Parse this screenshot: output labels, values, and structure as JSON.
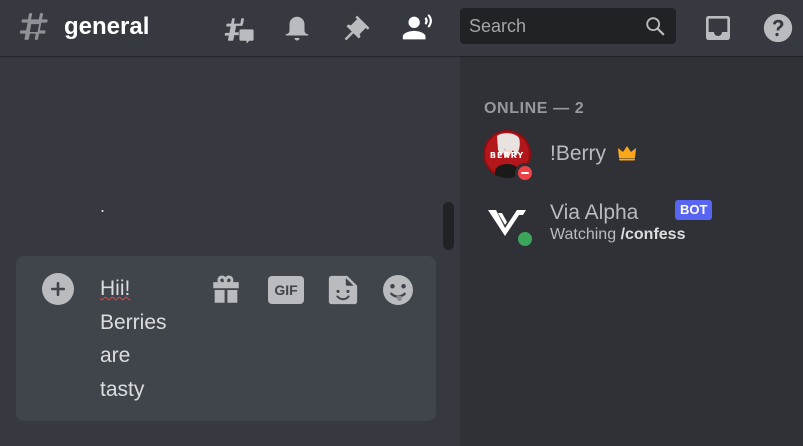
{
  "header": {
    "channel_name": "general",
    "search_placeholder": "Search"
  },
  "icons": {
    "channel": "hash-icon",
    "threads": "threads-icon",
    "notifications": "bell-icon",
    "pinned": "pin-icon",
    "members": "members-icon",
    "search": "search-icon",
    "inbox": "inbox-icon",
    "help": "help-icon"
  },
  "chat": {
    "stray_text": ".",
    "composer": {
      "message_words": [
        "Hii!",
        "Berries",
        "are",
        "tasty"
      ],
      "gif_label": "GIF"
    }
  },
  "members": {
    "group_header": "ONLINE — 2",
    "list": [
      {
        "name": "!Berry",
        "avatar_text": "BERRY",
        "status": "dnd",
        "name_color": "#b9bbbe",
        "badge": "crown"
      },
      {
        "name": "Via Alpha",
        "tag": "BOT",
        "status": "online",
        "activity_prefix": "Watching",
        "activity_detail": "/confess",
        "name_color": "#b9bbbe"
      }
    ]
  },
  "colors": {
    "background": "#36393f",
    "sidebar": "#2f3136",
    "composer": "#40444b",
    "search": "#202225",
    "blurple": "#5865f2",
    "online": "#3ba55c",
    "dnd": "#ed4245",
    "crown": "#faa81a"
  }
}
